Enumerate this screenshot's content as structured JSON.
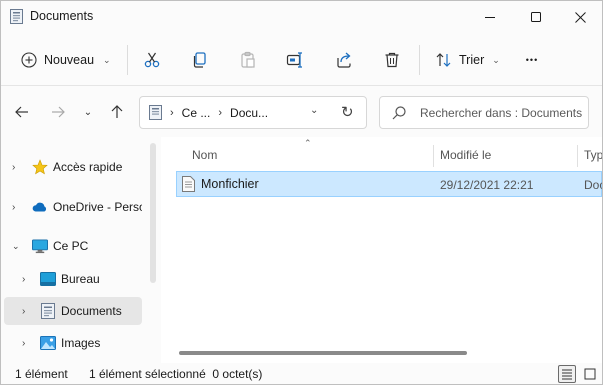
{
  "window": {
    "title": "Documents"
  },
  "toolbar": {
    "new_label": "Nouveau",
    "sort_label": "Trier",
    "more_label": "•••"
  },
  "address": {
    "crumbs": [
      "Ce ...",
      "Docu..."
    ],
    "separator": "›"
  },
  "search": {
    "placeholder": "Rechercher dans : Documents"
  },
  "nav": {
    "items": [
      {
        "label": "Accès rapide",
        "icon": "star-icon"
      },
      {
        "label": "OneDrive - Perso",
        "icon": "cloud-icon"
      },
      {
        "label": "Ce PC",
        "icon": "computer-icon"
      },
      {
        "label": "Bureau",
        "icon": "desktop-icon"
      },
      {
        "label": "Documents",
        "icon": "documents-icon",
        "selected": true
      },
      {
        "label": "Images",
        "icon": "images-icon"
      }
    ]
  },
  "filelist": {
    "columns": [
      "Nom",
      "Modifié le",
      "Typ"
    ],
    "rows": [
      {
        "name": "Monfichier",
        "modified": "29/12/2021 22:21",
        "type": "Doc"
      }
    ]
  },
  "status": {
    "count": "1 élément",
    "selection": "1 élément sélectionné  0 octet(s)"
  },
  "colors": {
    "accent": "#0067c0",
    "selection_bg": "#cce8ff",
    "selection_border": "#99d1ff"
  }
}
